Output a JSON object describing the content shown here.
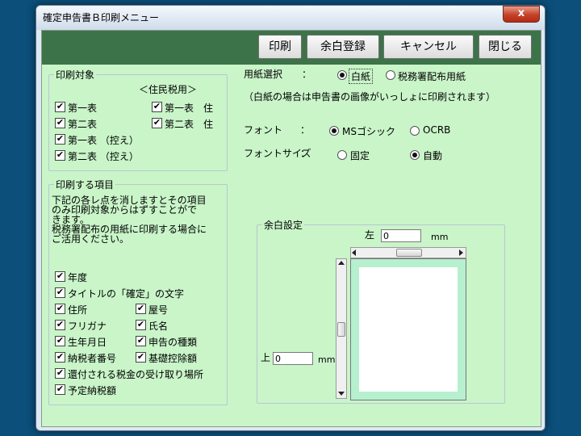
{
  "window": {
    "title": "確定申告書Ｂ印刷メニュー",
    "close_glyph": "x"
  },
  "toolbar": {
    "print": "印刷",
    "margin_register": "余白登録",
    "cancel": "キャンセル",
    "close": "閉じる"
  },
  "print_target": {
    "legend": "印刷対象",
    "resident_tax_label": "＜住民税用＞",
    "items": [
      {
        "label": "第一表",
        "checked": true
      },
      {
        "label": "第二表",
        "checked": true
      },
      {
        "label": "第一表 （控え）",
        "checked": true
      },
      {
        "label": "第二表 （控え）",
        "checked": true
      },
      {
        "label": "第一表　住",
        "checked": true
      },
      {
        "label": "第二表　住",
        "checked": true
      }
    ]
  },
  "print_items": {
    "legend": "印刷する項目",
    "description": "下記の各レ点を消しますとその項目\nのみ印刷対象からはずすことがで\nきます。\n税務署配布の用紙に印刷する場合に\nご活用ください。",
    "items": [
      {
        "label": "年度",
        "checked": true
      },
      {
        "label": "タイトルの「確定」の文字",
        "checked": true
      },
      {
        "label": "住所",
        "checked": true
      },
      {
        "label": "屋号",
        "checked": true
      },
      {
        "label": "フリガナ",
        "checked": true
      },
      {
        "label": "氏名",
        "checked": true
      },
      {
        "label": "生年月日",
        "checked": true
      },
      {
        "label": "申告の種類",
        "checked": true
      },
      {
        "label": "納税者番号",
        "checked": true
      },
      {
        "label": "基礎控除額",
        "checked": true
      },
      {
        "label": "還付される税金の受け取り場所",
        "checked": true
      },
      {
        "label": "予定納税額",
        "checked": true
      }
    ]
  },
  "paper": {
    "label": "用紙選択",
    "colon": "：",
    "options": [
      "白紙",
      "税務署配布用紙"
    ],
    "selected": "白紙",
    "note": "（白紙の場合は申告書の画像がいっしょに印刷されます）"
  },
  "font": {
    "label": "フォント",
    "colon": "：",
    "options": [
      "MSゴシック",
      "OCRB"
    ],
    "selected": "MSゴシック"
  },
  "font_size": {
    "label": "フォントサイズ",
    "colon": "：",
    "options": [
      "固定",
      "自動"
    ],
    "selected": "自動"
  },
  "margin": {
    "legend": "余白設定",
    "left_label": "左",
    "left_value": "0",
    "top_label": "上",
    "top_value": "0",
    "unit": "mm"
  },
  "colors": {
    "toolbar": "#3d7349",
    "form_bg": "#c9f5c9",
    "preview_bg": "#b6f0cf"
  }
}
